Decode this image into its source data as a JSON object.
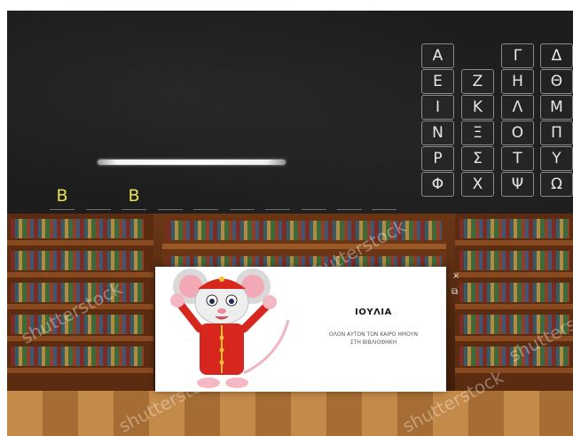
{
  "game": {
    "word_slots": [
      "B",
      "",
      "B",
      "",
      "",
      "",
      "",
      "",
      "",
      ""
    ],
    "letter_keys": [
      "Α",
      "",
      "Γ",
      "Δ",
      "Ε",
      "Ζ",
      "Η",
      "Θ",
      "Ι",
      "Κ",
      "Λ",
      "Μ",
      "Ν",
      "Ξ",
      "Ο",
      "Π",
      "Ρ",
      "Σ",
      "Τ",
      "Υ",
      "Φ",
      "Χ",
      "Ψ",
      "Ω"
    ]
  },
  "dialog": {
    "title": "ΙΟΥΛΙΑ",
    "message_line1": "ΟΛΟΝ ΑΥΤΟΝ ΤΟΝ ΚΑΙΡΟ ΗΜΟΥΝ",
    "message_line2": "ΣΤΗ ΒΙΒΛΙΟΘΗΚΗ",
    "close_icon": "×",
    "expand_icon": "⧉"
  },
  "watermark": "shutterstock",
  "colors": {
    "board": "#1d1d1d",
    "slot_letter": "#e9e25a",
    "key_text": "#e8e8e8"
  }
}
